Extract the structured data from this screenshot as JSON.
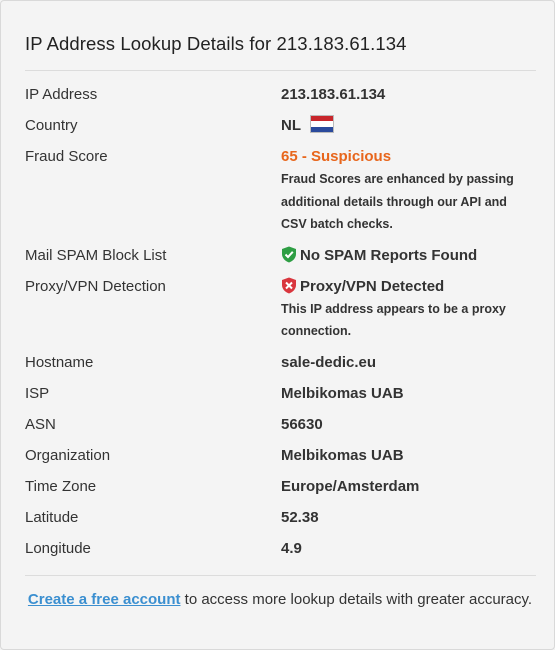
{
  "header": {
    "title": "IP Address Lookup Details for 213.183.61.134"
  },
  "details": {
    "ip_label": "IP Address",
    "ip_value": "213.183.61.134",
    "country_label": "Country",
    "country_value": "NL",
    "fraud_label": "Fraud Score",
    "fraud_value": "65 - Suspicious",
    "fraud_note": "Fraud Scores are enhanced by passing additional details through our API and CSV batch checks.",
    "spam_label": "Mail SPAM Block List",
    "spam_value": "No SPAM Reports Found",
    "proxy_label": "Proxy/VPN Detection",
    "proxy_value": "Proxy/VPN Detected",
    "proxy_note": "This IP address appears to be a proxy connection.",
    "hostname_label": "Hostname",
    "hostname_value": "sale-dedic.eu",
    "isp_label": "ISP",
    "isp_value": "Melbikomas UAB",
    "asn_label": "ASN",
    "asn_value": "56630",
    "org_label": "Organization",
    "org_value": "Melbikomas UAB",
    "tz_label": "Time Zone",
    "tz_value": "Europe/Amsterdam",
    "lat_label": "Latitude",
    "lat_value": "52.38",
    "lon_label": "Longitude",
    "lon_value": "4.9"
  },
  "footer": {
    "link_text": "Create a free account",
    "text": " to access more lookup details with greater accuracy."
  },
  "icons": {
    "flag": "netherlands-flag-icon",
    "spam_status": "shield-check-icon",
    "proxy_status": "shield-x-icon"
  },
  "colors": {
    "fraud_orange": "#e8661c",
    "link_blue": "#3b8fd0",
    "ok_green": "#2e9e44",
    "alert_red": "#d9363e"
  }
}
